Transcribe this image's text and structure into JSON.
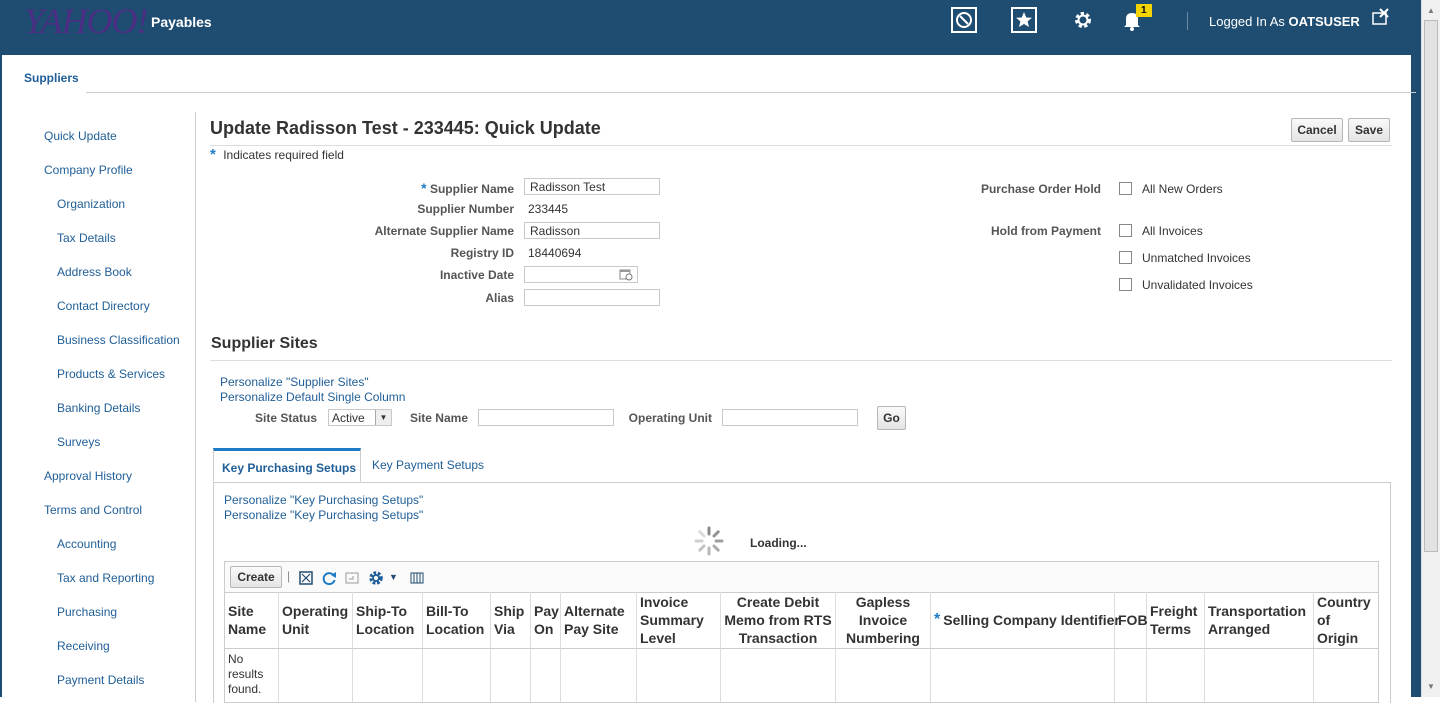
{
  "header": {
    "logo": "YAHOO!",
    "app_title": "Payables",
    "logged_in_prefix": "Logged In As",
    "logged_in_user": "OATSUSER",
    "notifications_count": "1",
    "icons": [
      "navigator-icon",
      "favorites-star-icon",
      "settings-gear-icon",
      "notifications-bell-icon",
      "close-icon"
    ]
  },
  "top_tab": "Suppliers",
  "sidebar": {
    "items": [
      {
        "label": "Quick Update",
        "level": 0
      },
      {
        "label": "Company Profile",
        "level": 0
      },
      {
        "label": "Organization",
        "level": 1
      },
      {
        "label": "Tax Details",
        "level": 1
      },
      {
        "label": "Address Book",
        "level": 1
      },
      {
        "label": "Contact Directory",
        "level": 1
      },
      {
        "label": "Business Classification",
        "level": 1
      },
      {
        "label": "Products & Services",
        "level": 1
      },
      {
        "label": "Banking Details",
        "level": 1
      },
      {
        "label": "Surveys",
        "level": 1
      },
      {
        "label": "Approval History",
        "level": 0
      },
      {
        "label": "Terms and Control",
        "level": 0
      },
      {
        "label": "Accounting",
        "level": 1
      },
      {
        "label": "Tax and Reporting",
        "level": 1
      },
      {
        "label": "Purchasing",
        "level": 1
      },
      {
        "label": "Receiving",
        "level": 1
      },
      {
        "label": "Payment Details",
        "level": 1
      }
    ]
  },
  "page": {
    "title": "Update Radisson Test - 233445: Quick Update",
    "cancel_label": "Cancel",
    "save_label": "Save",
    "required_note": "Indicates required field"
  },
  "form": {
    "supplier_name_label": "Supplier Name",
    "supplier_name_value": "Radisson Test",
    "supplier_number_label": "Supplier Number",
    "supplier_number_value": "233445",
    "alternate_name_label": "Alternate Supplier Name",
    "alternate_name_value": "Radisson",
    "registry_id_label": "Registry ID",
    "registry_id_value": "18440694",
    "inactive_date_label": "Inactive Date",
    "inactive_date_value": "",
    "alias_label": "Alias",
    "alias_value": "",
    "po_hold_label": "Purchase Order Hold",
    "po_hold_option": "All New Orders",
    "payment_hold_label": "Hold from Payment",
    "payment_hold_options": [
      "All Invoices",
      "Unmatched Invoices",
      "Unvalidated Invoices"
    ]
  },
  "sites": {
    "title": "Supplier Sites",
    "personalize_links": [
      "Personalize \"Supplier Sites\"",
      "Personalize Default Single Column"
    ],
    "site_status_label": "Site Status",
    "site_status_value": "Active",
    "site_name_label": "Site Name",
    "operating_unit_label": "Operating Unit",
    "go_label": "Go",
    "tabs": [
      "Key Purchasing Setups",
      "Key Payment Setups"
    ],
    "tab_links": [
      "Personalize \"Key Purchasing Setups\"",
      "Personalize \"Key Purchasing Setups\""
    ],
    "loading_text": "Loading...",
    "create_label": "Create",
    "columns": [
      "Site Name",
      "Operating Unit",
      "Ship-To Location",
      "Bill-To Location",
      "Ship Via",
      "Pay On",
      "Alternate Pay Site",
      "Invoice Summary Level",
      "Create Debit Memo from RTS Transaction",
      "Gapless Invoice Numbering",
      "Selling Company Identifier",
      "FOB",
      "Freight Terms",
      "Transportation Arranged",
      "Country of Origin"
    ],
    "no_results": "No results found."
  },
  "colors": {
    "header_bg": "#1f4c71",
    "link": "#1f5e97",
    "accent": "#1f7bc4",
    "badge": "#f4d400"
  }
}
